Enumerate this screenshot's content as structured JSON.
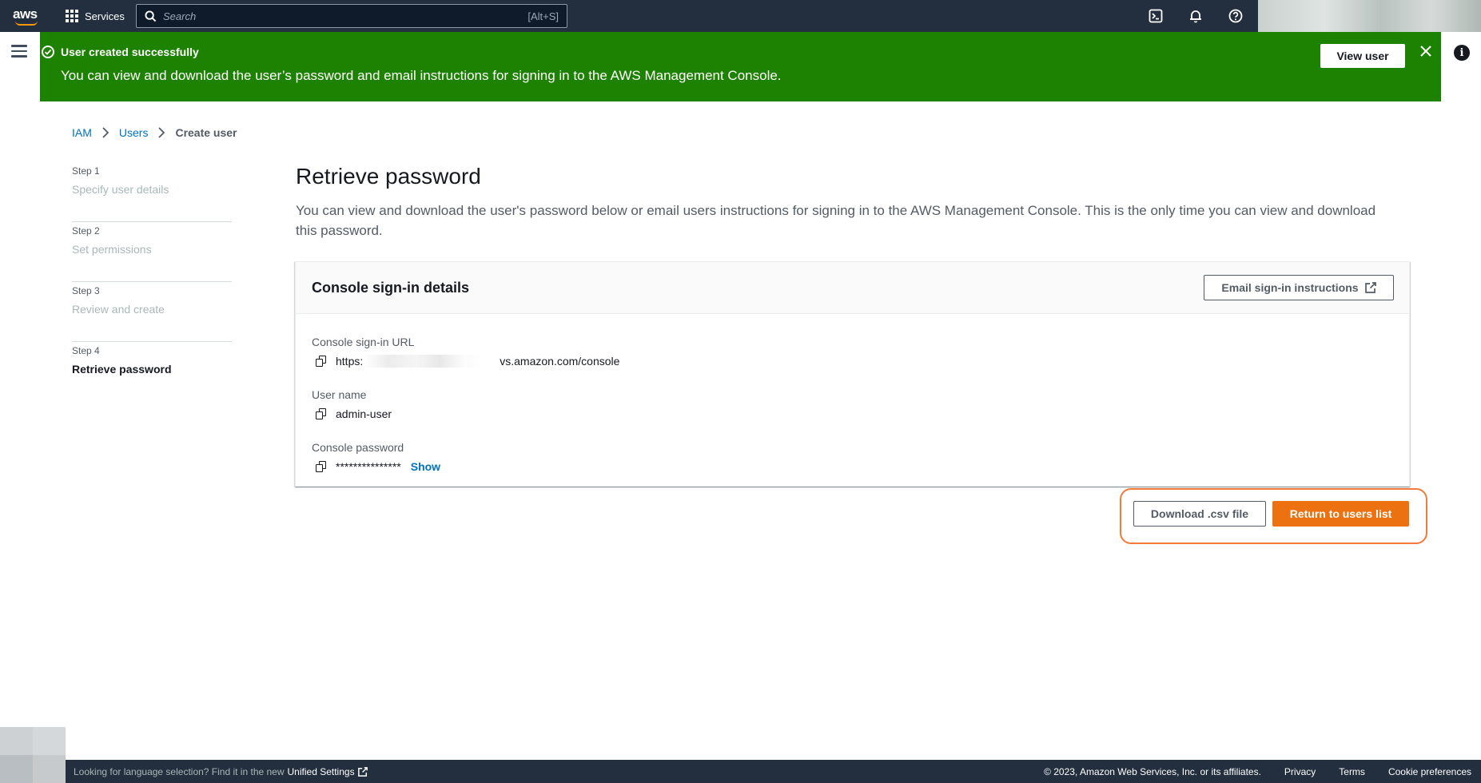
{
  "topnav": {
    "logo_text": "aws",
    "services_label": "Services",
    "search_placeholder": "Search",
    "search_hint": "[Alt+S]"
  },
  "flash": {
    "title": "User created successfully",
    "message": "You can view and download the user’s password and email instructions for signing in to the AWS Management Console.",
    "button_label": "View user",
    "type": "success",
    "color": "#1d8102"
  },
  "breadcrumb": {
    "items": [
      {
        "label": "IAM"
      },
      {
        "label": "Users"
      },
      {
        "label": "Create user"
      }
    ]
  },
  "steps": [
    {
      "number": "Step 1",
      "label": "Specify user details",
      "state": "disabled"
    },
    {
      "number": "Step 2",
      "label": "Set permissions",
      "state": "disabled"
    },
    {
      "number": "Step 3",
      "label": "Review and create",
      "state": "disabled"
    },
    {
      "number": "Step 4",
      "label": "Retrieve password",
      "state": "active"
    }
  ],
  "main": {
    "title": "Retrieve password",
    "description": "You can view and download the user's password below or email users instructions for signing in to the AWS Management Console. This is the only time you can view and download this password."
  },
  "panel": {
    "title": "Console sign-in details",
    "email_button_label": "Email sign-in instructions",
    "fields": {
      "url": {
        "label": "Console sign-in URL",
        "value_prefix": "https:",
        "value_suffix": "vs.amazon.com/console"
      },
      "username": {
        "label": "User name",
        "value": "admin-user"
      },
      "password": {
        "label": "Console password",
        "value": "***************",
        "show_label": "Show"
      }
    }
  },
  "actions": {
    "download_label": "Download .csv file",
    "return_label": "Return to users list",
    "primary_color": "#ec7211",
    "highlight_color": "#f27a3a"
  },
  "footer": {
    "lang_text": "Looking for language selection? Find it in the new",
    "unified_settings": "Unified Settings",
    "copyright": "© 2023, Amazon Web Services, Inc. or its affiliates.",
    "links": [
      "Privacy",
      "Terms",
      "Cookie preferences"
    ]
  },
  "icons": {
    "services": "grid-icon",
    "search": "search-icon",
    "cloudshell": "terminal-icon",
    "notifications": "bell-icon",
    "help": "help-icon",
    "flash_status": "check-circle-icon",
    "flash_dismiss": "close-icon",
    "menu": "hamburger-icon",
    "info": "info-icon",
    "copy": "copy-icon",
    "external": "external-link-icon"
  }
}
